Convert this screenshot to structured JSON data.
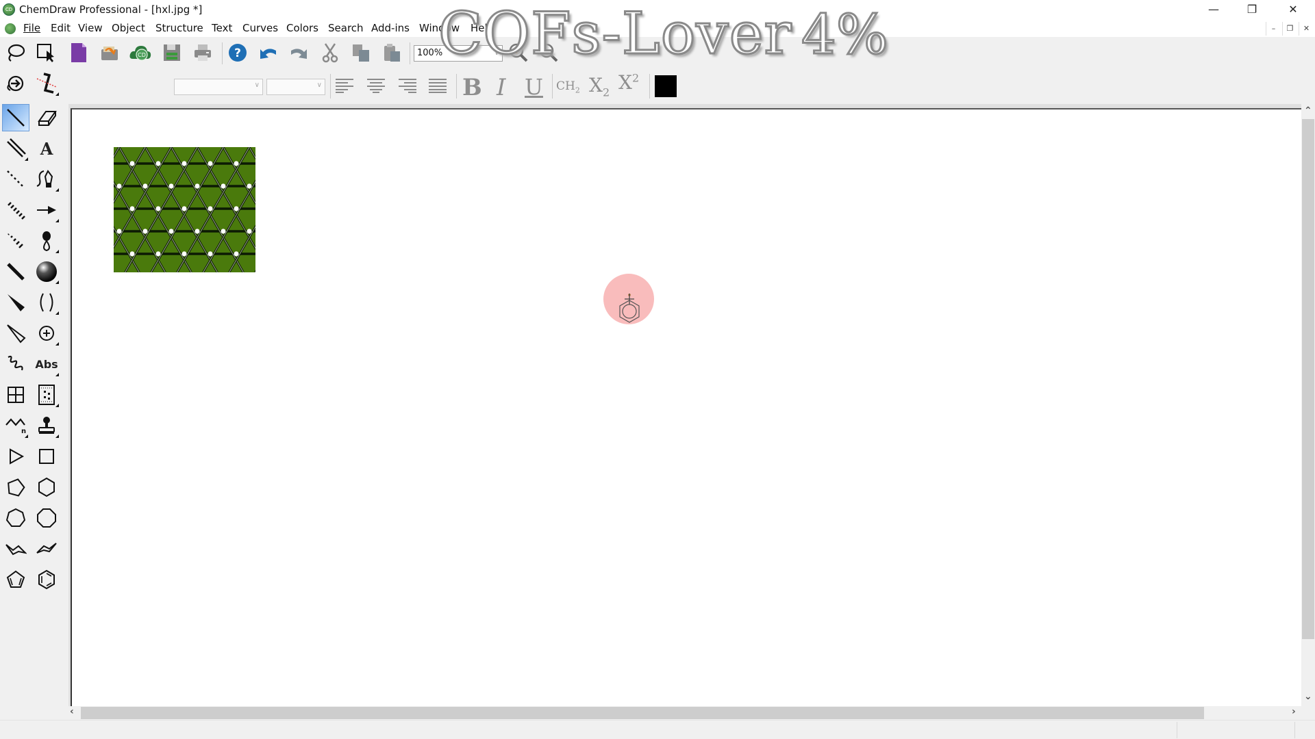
{
  "window": {
    "title": "ChemDraw Professional - [hxl.jpg *]",
    "controls": {
      "minimize": "—",
      "restore": "❐",
      "close": "✕"
    },
    "doc_controls": {
      "minimize": "–",
      "restore": "❐",
      "close": "✕"
    }
  },
  "menubar": {
    "items": [
      {
        "label": "File"
      },
      {
        "label": "Edit"
      },
      {
        "label": "View"
      },
      {
        "label": "Object"
      },
      {
        "label": "Structure"
      },
      {
        "label": "Text"
      },
      {
        "label": "Curves"
      },
      {
        "label": "Colors"
      },
      {
        "label": "Search"
      },
      {
        "label": "Add-ins"
      },
      {
        "label": "Window"
      },
      {
        "label": "Help"
      }
    ]
  },
  "toolbar": {
    "buttons": [
      "lasso-icon",
      "marquee-select-icon",
      "new-document-icon",
      "open-icon",
      "chemdraw-cloud-icon",
      "save-icon",
      "print-icon",
      "help-icon",
      "undo-icon",
      "redo-icon",
      "cut-icon",
      "copy-icon",
      "paste-icon"
    ],
    "zoom_value": "100%",
    "zoom_in": "zoom-in-icon",
    "zoom_out": "zoom-out-icon"
  },
  "format_bar": {
    "font_family": "",
    "font_size": "",
    "align": [
      "align-left",
      "align-center",
      "align-right",
      "justify"
    ],
    "bold": "B",
    "italic": "I",
    "underline": "U",
    "formula": "CH",
    "formula_sub": "2",
    "subscript": "X",
    "subscript_mark": "2",
    "superscript": "X",
    "superscript_mark": "2",
    "color": "#000000"
  },
  "toolbox": {
    "tools": [
      [
        "orbit-tool",
        "structure-perspective-tool"
      ],
      [
        "solid-bond-tool",
        "eraser-tool"
      ],
      [
        "double-bond-tool",
        "text-tool"
      ],
      [
        "dashed-bond-tool",
        "pen-tool"
      ],
      [
        "hashed-bond-tool",
        "arrow-tool"
      ],
      [
        "hashed-wedge-bond-tool",
        "orbital-tool"
      ],
      [
        "bold-bond-tool",
        "drawing-elements-tool"
      ],
      [
        "wedge-bond-tool",
        "brackets-tool"
      ],
      [
        "hollow-wedge-bond-tool",
        "chemical-symbols-tool"
      ],
      [
        "wavy-bond-tool",
        "query-tool"
      ],
      [
        "table-tool",
        "tlc-plate-tool"
      ],
      [
        "acyclic-chain-tool",
        "template-tool"
      ],
      [
        "cyclopropane-tool",
        "cyclobutane-tool"
      ],
      [
        "cyclopentane-tool",
        "cyclohexane-tool"
      ],
      [
        "cycloheptane-tool",
        "cyclooctane-tool"
      ],
      [
        "cyclohexane-chair-1-tool",
        "cyclohexane-chair-2-tool"
      ],
      [
        "cyclopentadiene-tool",
        "benzene-tool"
      ]
    ],
    "abs_label": "Abs",
    "text_label": "A",
    "chain_sub": "n",
    "active": "solid-bond-tool"
  },
  "watermark": {
    "text": "COFs-Lover",
    "percent": "4%"
  },
  "canvas": {
    "objects": [
      {
        "type": "image",
        "name": "hxl.jpg",
        "description": "green kagome/triangular lattice",
        "background": "#4a7a0c",
        "node_color": "#ffffff"
      }
    ],
    "cursor": "benzene-template-cursor",
    "cursor_highlight": "#f6a0a0"
  }
}
